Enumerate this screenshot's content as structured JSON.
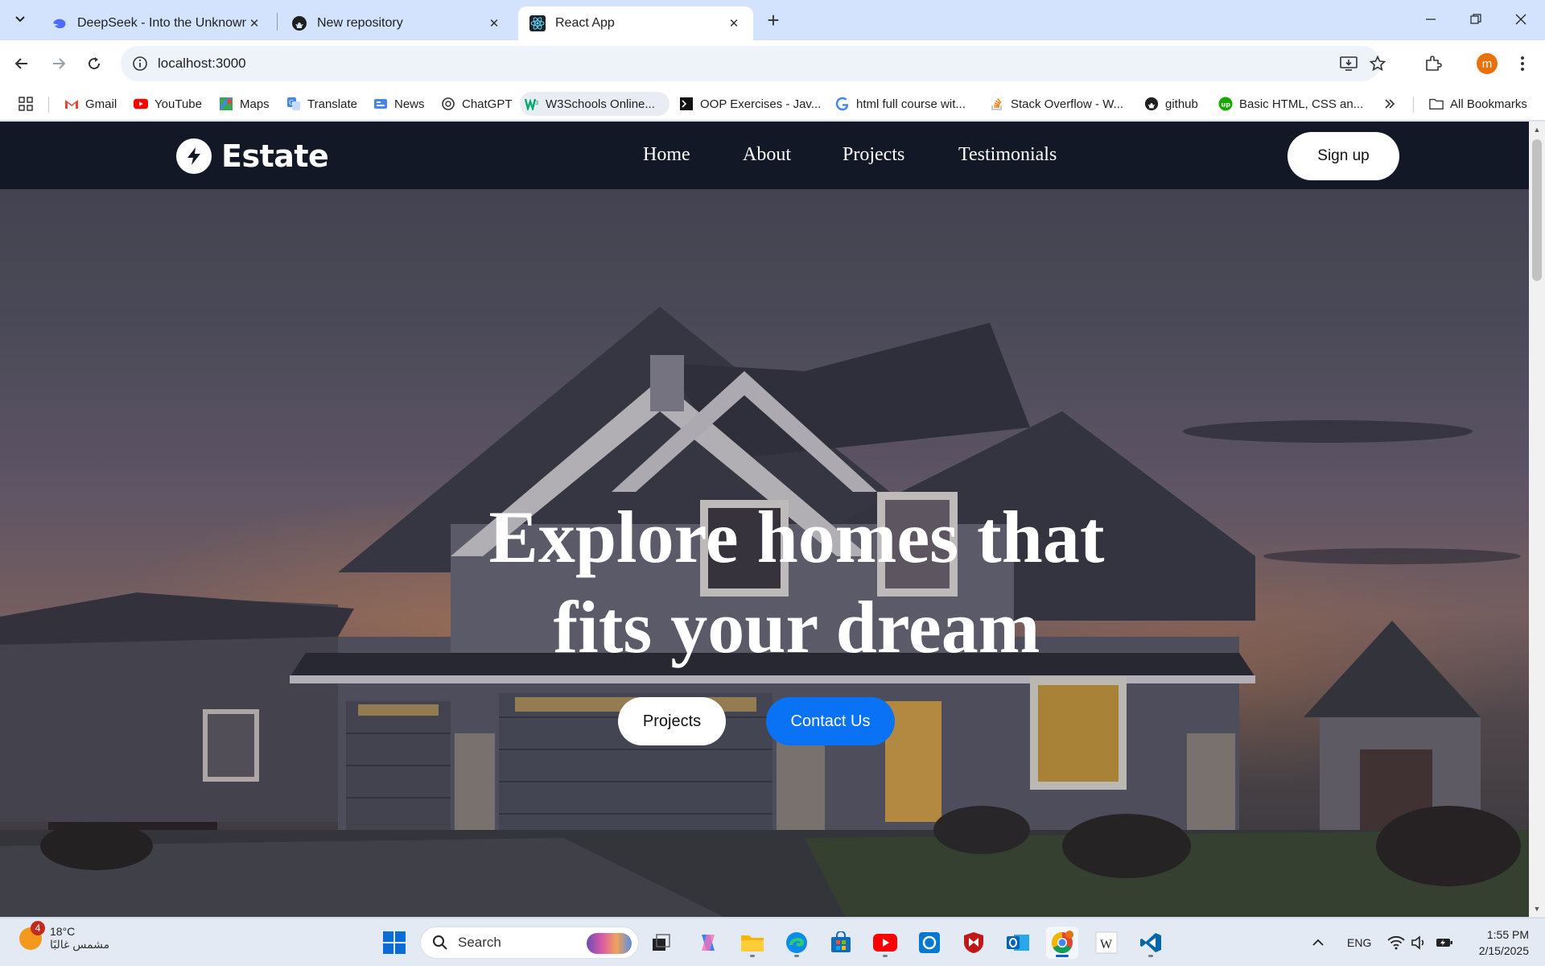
{
  "browser": {
    "tabs": [
      {
        "title": "DeepSeek - Into the Unknown",
        "icon": "deepseek-icon",
        "active": false
      },
      {
        "title": "New repository",
        "icon": "github-icon",
        "active": false
      },
      {
        "title": "React App",
        "icon": "react-icon",
        "active": true
      }
    ],
    "url": "localhost:3000",
    "profile_initial": "m",
    "bookmarks": [
      {
        "label": "Gmail",
        "icon": "gmail-icon"
      },
      {
        "label": "YouTube",
        "icon": "youtube-icon"
      },
      {
        "label": "Maps",
        "icon": "maps-icon"
      },
      {
        "label": "Translate",
        "icon": "translate-icon"
      },
      {
        "label": "News",
        "icon": "news-icon"
      },
      {
        "label": "ChatGPT",
        "icon": "chatgpt-icon"
      },
      {
        "label": "W3Schools Online...",
        "icon": "w3schools-icon"
      },
      {
        "label": "OOP Exercises - Jav...",
        "icon": "terminal-icon"
      },
      {
        "label": "html full course wit...",
        "icon": "google-icon"
      },
      {
        "label": "Stack Overflow - W...",
        "icon": "stackoverflow-icon"
      },
      {
        "label": "github",
        "icon": "github-icon"
      },
      {
        "label": "Basic HTML, CSS an...",
        "icon": "upwork-icon"
      }
    ],
    "all_bookmarks_label": "All Bookmarks"
  },
  "site": {
    "logo_text": "Estate",
    "nav": [
      "Home",
      "About",
      "Projects",
      "Testimonials"
    ],
    "signup_label": "Sign up",
    "hero_line1": "Explore homes that",
    "hero_line2": "fits your dream",
    "btn_projects": "Projects",
    "btn_contact": "Contact Us"
  },
  "taskbar": {
    "weather_temp": "18°C",
    "weather_condition": "مشمس غالبًا",
    "weather_badge": "4",
    "search_label": "Search",
    "language": "ENG",
    "time": "1:55 PM",
    "date": "2/15/2025"
  },
  "colors": {
    "accent_blue": "#0a73f5",
    "navbar_bg": "#121826",
    "tabstrip_bg": "#d3e3fd"
  }
}
